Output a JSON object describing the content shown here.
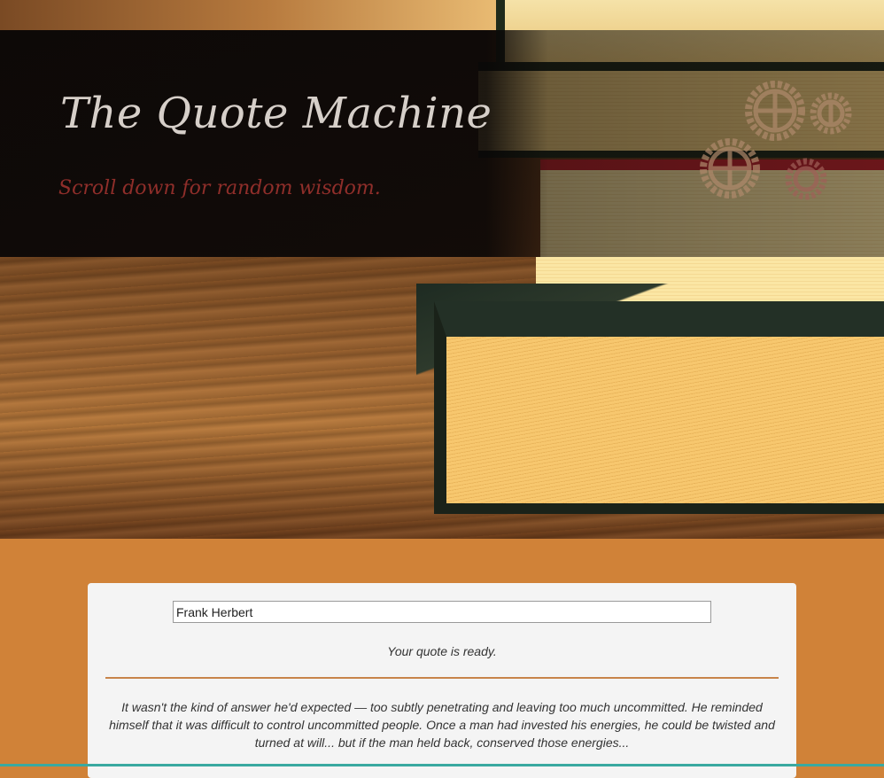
{
  "hero": {
    "title": "The Quote Machine",
    "subtitle": "Scroll down for random wisdom."
  },
  "quote_box": {
    "author_value": "Frank Herbert",
    "status": "Your quote is ready.",
    "quote_text": "It wasn't the kind of answer he'd expected — too subtly penetrating and leaving too much uncommitted. He reminded himself that it was difficult to control uncommitted people. Once a man had invested his energies, he could be twisted and turned at will... but if the man held back, conserved those energies..."
  },
  "colors": {
    "page_background": "#d08238",
    "title_color": "#d6cfc9",
    "subtitle_color": "#8f2e2a",
    "card_background": "#f4f4f4",
    "divider_color": "#c8844a"
  },
  "icons": {
    "gears": "gears-icon"
  }
}
